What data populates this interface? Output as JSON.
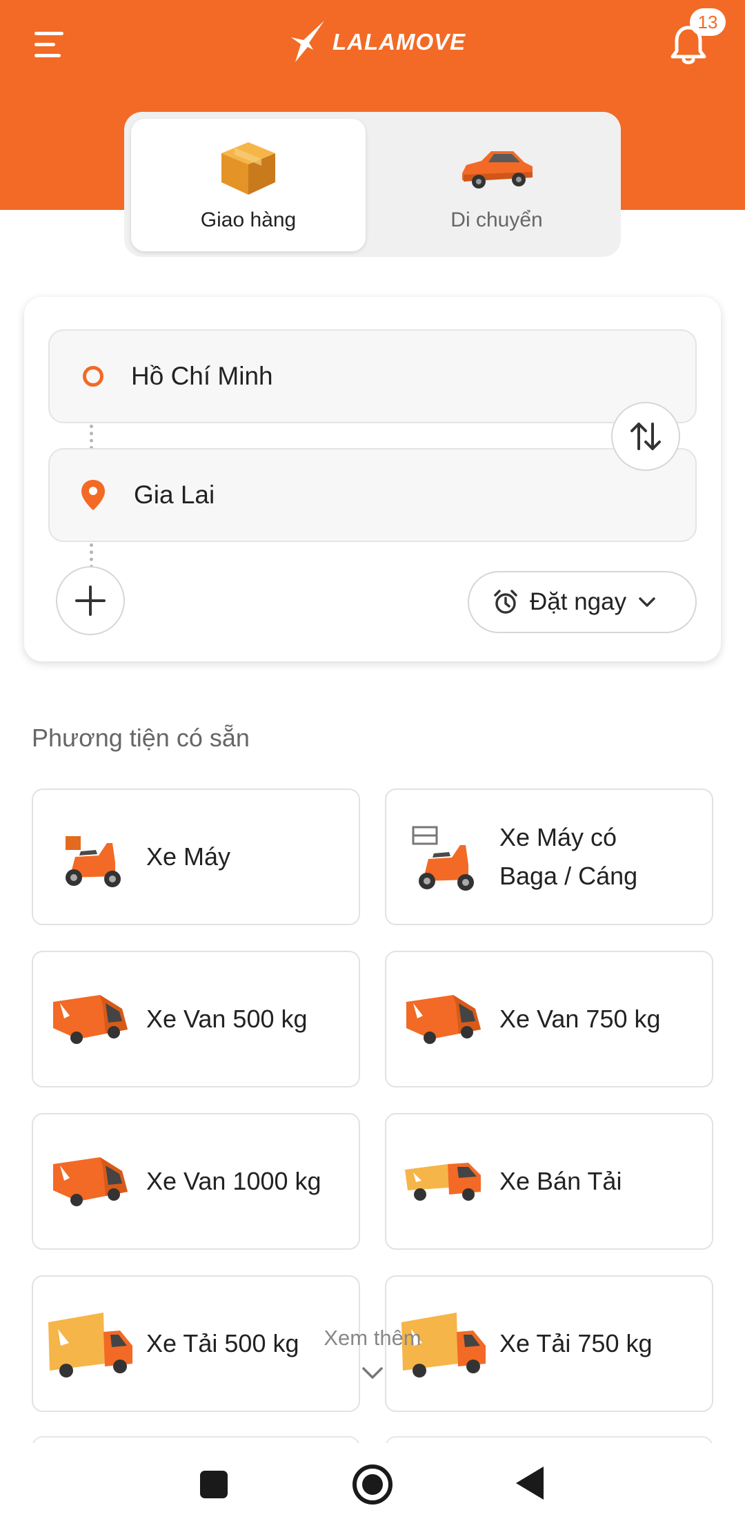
{
  "header": {
    "logo_text": "LALAMOVE",
    "notification_count": "13",
    "brand_color": "#f26a25"
  },
  "service_tabs": [
    {
      "label": "Giao hàng",
      "icon": "package-box-icon",
      "active": true
    },
    {
      "label": "Di chuyển",
      "icon": "car-icon",
      "active": false
    }
  ],
  "route": {
    "pickup": "Hồ Chí Minh",
    "dropoff": "Gia Lai",
    "schedule_label": "Đặt ngay",
    "icons": [
      "pickup-dot-icon",
      "location-pin-icon",
      "swap-arrows-icon",
      "plus-icon",
      "alarm-clock-icon",
      "chevron-down-icon"
    ]
  },
  "vehicles_section": {
    "title": "Phương tiện có sẵn",
    "items": [
      {
        "label": "Xe Máy",
        "icon": "motorbike-icon"
      },
      {
        "label": "Xe Máy có Baga / Cáng",
        "icon": "motorbike-rack-icon"
      },
      {
        "label": "Xe Van 500 kg",
        "icon": "van-icon"
      },
      {
        "label": "Xe Van 750 kg",
        "icon": "van-icon"
      },
      {
        "label": "Xe Van 1000 kg",
        "icon": "van-icon"
      },
      {
        "label": "Xe Bán Tải",
        "icon": "pickup-truck-icon"
      },
      {
        "label": "Xe Tải 500 kg",
        "icon": "box-truck-icon"
      },
      {
        "label": "Xe Tải 750 kg",
        "icon": "box-truck-icon"
      }
    ],
    "see_more": "Xem thêm"
  },
  "system_nav": {
    "icons": [
      "recents-square-icon",
      "home-circle-icon",
      "back-triangle-icon"
    ]
  }
}
